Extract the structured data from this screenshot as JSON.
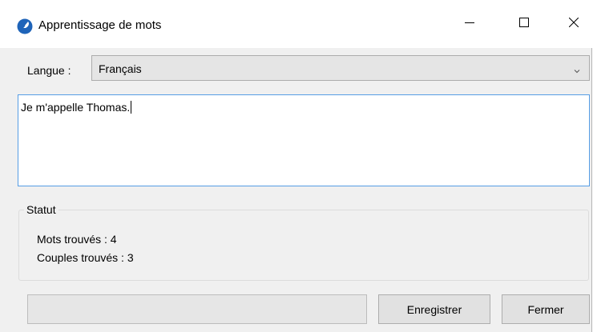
{
  "window": {
    "title": "Apprentissage de mots",
    "app_icon": "feather-pen-icon",
    "controls": [
      "minimize-icon",
      "maximize-icon",
      "close-icon"
    ]
  },
  "language": {
    "label": "Langue :",
    "selected": "Français"
  },
  "editor": {
    "text": "Je m'appelle Thomas."
  },
  "status": {
    "title": "Statut",
    "words_found": "Mots trouvés : 4",
    "pairs_found": "Couples trouvés : 3"
  },
  "progress": {
    "value": 0
  },
  "buttons": {
    "save": "Enregistrer",
    "close": "Fermer"
  },
  "colors": {
    "accent": "#569de5",
    "icon_blue": "#1f64b9",
    "window_bg": "#f0f0f0"
  }
}
